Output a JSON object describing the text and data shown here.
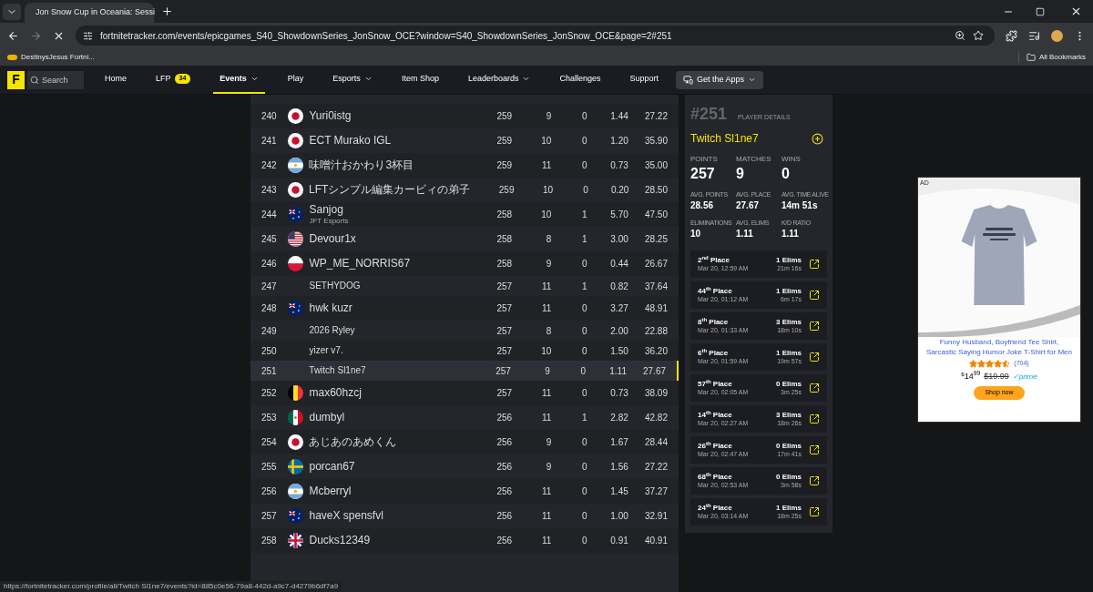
{
  "browser": {
    "tab_title": "Jon Snow Cup in Oceania: Sessi",
    "url": "fortnitetracker.com/events/epicgames_S40_ShowdownSeries_JonSnow_OCE?window=S40_ShowdownSeries_JonSnow_OCE&page=2#251",
    "bookmarks": [
      {
        "label": "DestinysJesus Fortni..."
      }
    ],
    "all_bookmarks": "All Bookmarks",
    "status_url": "https://fortnitetracker.com/profile/all/Twitch Sl1ne7/events?id=885c0e56-79a8-442d-a9c7-d4279b6df7a9"
  },
  "nav": {
    "logo": "F",
    "search": {
      "placeholder": "Search"
    },
    "items": [
      {
        "label": "Home",
        "selected": false,
        "dropdown": false
      },
      {
        "label": "LFP",
        "selected": false,
        "dropdown": false,
        "badge": "34"
      },
      {
        "label": "Events",
        "selected": true,
        "dropdown": true
      },
      {
        "label": "Play",
        "selected": false,
        "dropdown": false
      },
      {
        "label": "Esports",
        "selected": false,
        "dropdown": true
      },
      {
        "label": "Item Shop",
        "selected": false,
        "dropdown": false
      },
      {
        "label": "Leaderboards",
        "selected": false,
        "dropdown": true
      },
      {
        "label": "Challenges",
        "selected": false,
        "dropdown": false
      },
      {
        "label": "Support",
        "selected": false,
        "dropdown": false
      }
    ],
    "apps_button": "Get the Apps"
  },
  "table": {
    "rows": [
      {
        "rank": "240",
        "kind": "jp",
        "name": "Yuri0istg",
        "points": "259",
        "matches": "9",
        "wins": "0",
        "kd": "1.44",
        "avg": "27.22",
        "selected": false
      },
      {
        "rank": "241",
        "kind": "jp",
        "name": "ECT Murako IGL",
        "points": "259",
        "matches": "10",
        "wins": "0",
        "kd": "1.20",
        "avg": "35.90",
        "selected": false
      },
      {
        "rank": "242",
        "kind": "ar",
        "name": "味噌汁おかわり3杯目",
        "points": "259",
        "matches": "11",
        "wins": "0",
        "kd": "0.73",
        "avg": "35.00",
        "selected": false
      },
      {
        "rank": "243",
        "kind": "jp",
        "name": "LFTシンプル編集カービィの弟子",
        "points": "259",
        "matches": "10",
        "wins": "0",
        "kd": "0.20",
        "avg": "28.50",
        "selected": false
      },
      {
        "rank": "244",
        "kind": "au",
        "name": "Sanjog",
        "team": "JFT Esports",
        "points": "258",
        "matches": "10",
        "wins": "1",
        "kd": "5.70",
        "avg": "47.50",
        "selected": false
      },
      {
        "rank": "245",
        "kind": "us",
        "name": "Devour1x",
        "points": "258",
        "matches": "8",
        "wins": "1",
        "kd": "3.00",
        "avg": "28.25",
        "selected": false
      },
      {
        "rank": "246",
        "kind": "pl",
        "name": "WP_ME_NORRIS67",
        "points": "258",
        "matches": "9",
        "wins": "0",
        "kd": "0.44",
        "avg": "26.67",
        "selected": false
      },
      {
        "rank": "247",
        "kind": "none",
        "name": "SETHYDOG",
        "points": "257",
        "matches": "11",
        "wins": "1",
        "kd": "0.82",
        "avg": "37.64",
        "selected": false
      },
      {
        "rank": "248",
        "kind": "au",
        "name": "hwk kuzr",
        "points": "257",
        "matches": "11",
        "wins": "0",
        "kd": "3.27",
        "avg": "48.91",
        "selected": false
      },
      {
        "rank": "249",
        "kind": "none",
        "name": "2026 Ryley",
        "points": "257",
        "matches": "8",
        "wins": "0",
        "kd": "2.00",
        "avg": "22.88",
        "selected": false
      },
      {
        "rank": "250",
        "kind": "none",
        "name": "yizer v7.",
        "points": "257",
        "matches": "10",
        "wins": "0",
        "kd": "1.50",
        "avg": "36.20",
        "selected": false
      },
      {
        "rank": "251",
        "kind": "none",
        "name": "Twitch Sl1ne7",
        "points": "257",
        "matches": "9",
        "wins": "0",
        "kd": "1.11",
        "avg": "27.67",
        "selected": true
      },
      {
        "rank": "252",
        "kind": "be",
        "name": "max60hzcj",
        "points": "257",
        "matches": "11",
        "wins": "0",
        "kd": "0.73",
        "avg": "38.09",
        "selected": false
      },
      {
        "rank": "253",
        "kind": "mx",
        "name": "dumbyl",
        "points": "256",
        "matches": "11",
        "wins": "1",
        "kd": "2.82",
        "avg": "42.82",
        "selected": false
      },
      {
        "rank": "254",
        "kind": "jp",
        "name": "あじあのあめくん",
        "points": "256",
        "matches": "9",
        "wins": "0",
        "kd": "1.67",
        "avg": "28.44",
        "selected": false
      },
      {
        "rank": "255",
        "kind": "se",
        "name": "porcan67",
        "points": "256",
        "matches": "9",
        "wins": "0",
        "kd": "1.56",
        "avg": "27.22",
        "selected": false
      },
      {
        "rank": "256",
        "kind": "ar",
        "name": "Mcberryl",
        "points": "256",
        "matches": "11",
        "wins": "0",
        "kd": "1.45",
        "avg": "37.27",
        "selected": false
      },
      {
        "rank": "257",
        "kind": "au",
        "name": "haveX spensfvl",
        "points": "256",
        "matches": "11",
        "wins": "0",
        "kd": "1.00",
        "avg": "32.91",
        "selected": false
      },
      {
        "rank": "258",
        "kind": "gb",
        "name": "Ducks12349",
        "points": "256",
        "matches": "11",
        "wins": "0",
        "kd": "0.91",
        "avg": "40.91",
        "selected": false
      }
    ]
  },
  "player": {
    "rank": "#251",
    "heading": "PLAYER DETAILS",
    "name": "Twitch Sl1ne7",
    "main_stats": [
      {
        "label": "POINTS",
        "value": "257"
      },
      {
        "label": "MATCHES",
        "value": "9"
      },
      {
        "label": "WINS",
        "value": "0"
      }
    ],
    "stats": [
      {
        "label": "AVG. POINTS",
        "value": "28.56"
      },
      {
        "label": "AVG. PLACE",
        "value": "27.67"
      },
      {
        "label": "AVG. TIME ALIVE",
        "value": "14m 51s"
      },
      {
        "label": "ELIMINATIONS",
        "value": "10"
      },
      {
        "label": "AVG. ELIMS",
        "value": "1.11"
      },
      {
        "label": "K/D RATIO",
        "value": "1.11"
      }
    ],
    "matches": [
      {
        "place": "2$^{nd}$ Place",
        "date": "Mar 20, 12:59 AM",
        "elims": "1 Elims",
        "time": "21m 16s"
      },
      {
        "place": "44$^{th}$ Place",
        "date": "Mar 20, 01:12 AM",
        "elims": "1 Elims",
        "time": "6m 17s"
      },
      {
        "place": "8$^{th}$ Place",
        "date": "Mar 20, 01:33 AM",
        "elims": "3 Elims",
        "time": "18m 10s"
      },
      {
        "place": "6$^{th}$ Place",
        "date": "Mar 20, 01:59 AM",
        "elims": "1 Elims",
        "time": "19m 57s"
      },
      {
        "place": "57$^{th}$ Place",
        "date": "Mar 20, 02:05 AM",
        "elims": "0 Elims",
        "time": "3m 25s"
      },
      {
        "place": "14$^{th}$ Place",
        "date": "Mar 20, 02:27 AM",
        "elims": "3 Elims",
        "time": "18m 26s"
      },
      {
        "place": "26$^{th}$ Place",
        "date": "Mar 20, 02:47 AM",
        "elims": "0 Elims",
        "time": "17m 41s"
      },
      {
        "place": "68$^{th}$ Place",
        "date": "Mar 20, 02:53 AM",
        "elims": "0 Elims",
        "time": "3m 58s"
      },
      {
        "place": "24$^{th}$ Place",
        "date": "Mar 20, 03:14 AM",
        "elims": "1 Elims",
        "time": "18m 25s"
      }
    ]
  },
  "ad": {
    "label": "AD",
    "title": "Funny Husband, Boyfriend Tee Shirt, Sarcastic Saying Humor Joke T-Shirt for Men",
    "stars": 4.5,
    "reviews": "(704)",
    "currency": "$",
    "price": "14$^{99}$",
    "old_price": "$19.99",
    "prime": "✓prime",
    "button": "Shop now"
  }
}
